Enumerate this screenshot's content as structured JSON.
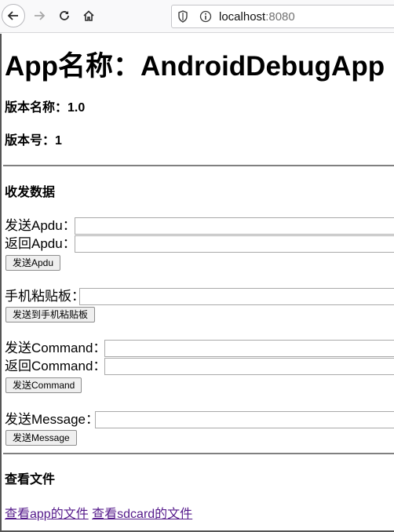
{
  "browser": {
    "url_host": "localhost",
    "url_port": ":8080"
  },
  "page": {
    "app_name": "App名称：AndroidDebugApp",
    "version_name": "版本名称：1.0",
    "version_code": "版本号：1",
    "section_data": "收发数据",
    "send_apdu_label": "发送Apdu：",
    "return_apdu_label": "返回Apdu：",
    "send_apdu_button": "发送Apdu",
    "clipboard_label": "手机粘贴板：",
    "send_clipboard_button": "发送到手机粘贴板",
    "send_command_label": "发送Command：",
    "return_command_label": "返回Command：",
    "send_command_button": "发送Command",
    "send_message_label": "发送Message：",
    "send_message_button": "发送Message",
    "section_files": "查看文件",
    "link_app_files": "查看app的文件",
    "link_sdcard_files": "查看sdcard的文件"
  }
}
